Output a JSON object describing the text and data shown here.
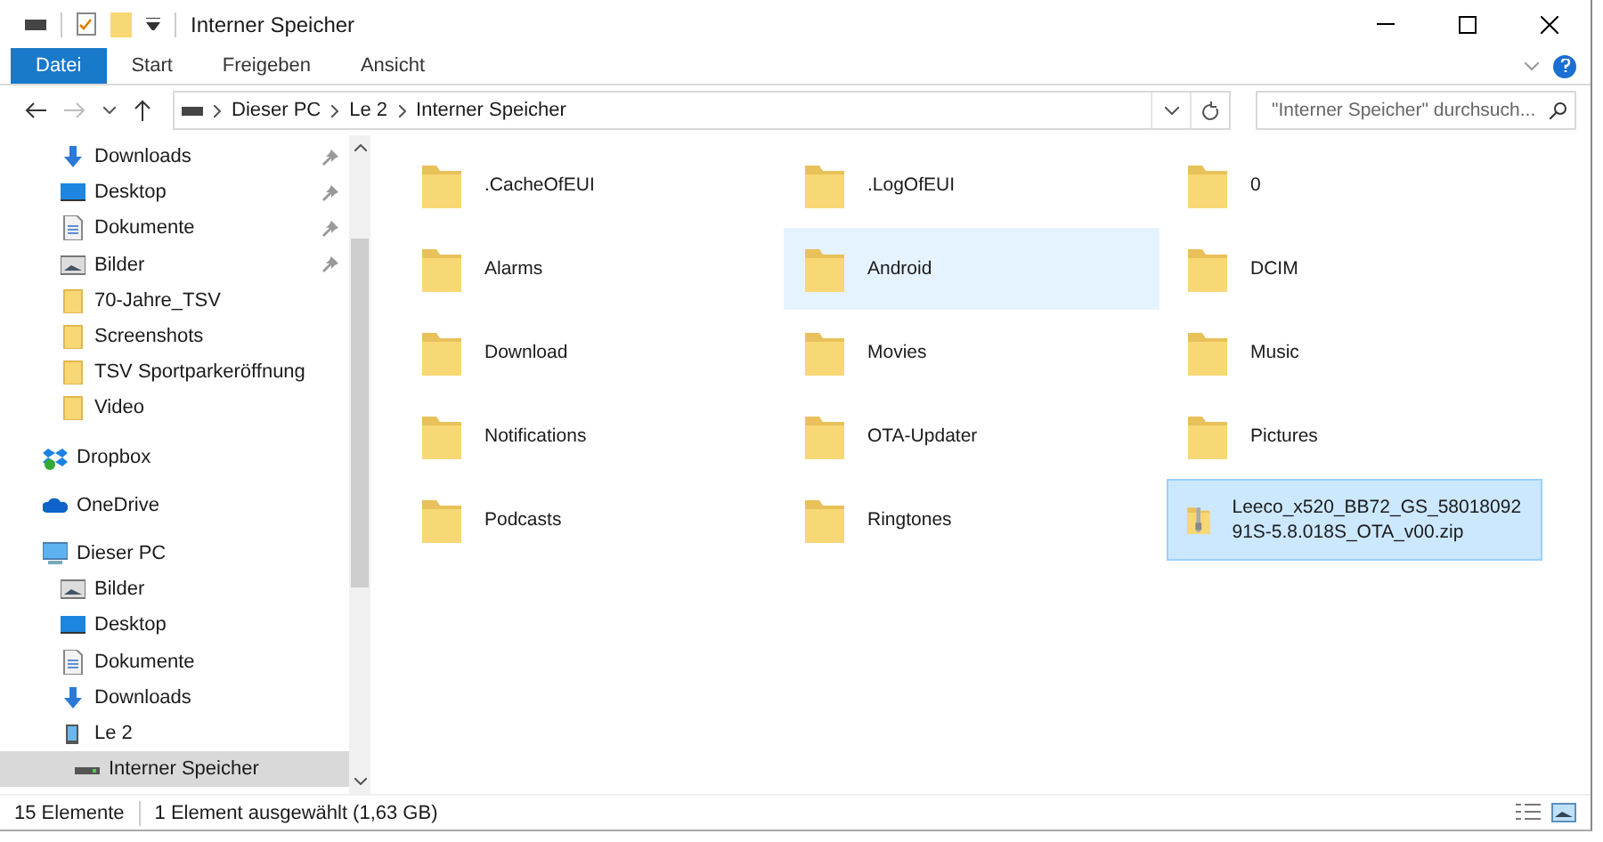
{
  "window": {
    "title": "Interner Speicher"
  },
  "ribbon_tabs": [
    {
      "label": "Datei",
      "selected": true
    },
    {
      "label": "Start",
      "selected": false
    },
    {
      "label": "Freigeben",
      "selected": false
    },
    {
      "label": "Ansicht",
      "selected": false
    }
  ],
  "address_bar": {
    "path": [
      "Dieser PC",
      "Le 2",
      "Interner Speicher"
    ]
  },
  "search": {
    "placeholder": "\"Interner Speicher\" durchsuch..."
  },
  "sidebar": {
    "items": [
      {
        "label": "Downloads",
        "kind": "download",
        "pinned": true,
        "selected": false
      },
      {
        "label": "Desktop",
        "kind": "desktop",
        "pinned": true,
        "selected": false
      },
      {
        "label": "Dokumente",
        "kind": "document",
        "pinned": true,
        "selected": false
      },
      {
        "label": "Bilder",
        "kind": "pictures",
        "pinned": true,
        "selected": false
      },
      {
        "label": "70-Jahre_TSV",
        "kind": "folder",
        "pinned": false,
        "selected": false
      },
      {
        "label": "Screenshots",
        "kind": "folder",
        "pinned": false,
        "selected": false
      },
      {
        "label": "TSV Sportparkeröffnung",
        "kind": "folder",
        "pinned": false,
        "selected": false
      },
      {
        "label": "Video",
        "kind": "folder",
        "pinned": false,
        "selected": false
      },
      {
        "label": "Dropbox",
        "kind": "dropbox",
        "pinned": false,
        "selected": false,
        "root": true
      },
      {
        "label": "OneDrive",
        "kind": "cloud",
        "pinned": false,
        "selected": false,
        "root": true
      },
      {
        "label": "Dieser PC",
        "kind": "pc",
        "pinned": false,
        "selected": false,
        "root": true,
        "children": [
          {
            "label": "Bilder",
            "kind": "pictures",
            "pinned": false,
            "selected": false
          },
          {
            "label": "Desktop",
            "kind": "desktop",
            "pinned": false,
            "selected": false
          },
          {
            "label": "Dokumente",
            "kind": "document",
            "pinned": false,
            "selected": false
          },
          {
            "label": "Downloads",
            "kind": "download",
            "pinned": false,
            "selected": false
          },
          {
            "label": "Le 2",
            "kind": "phone",
            "pinned": false,
            "selected": false,
            "children": [
              {
                "label": "Interner Speicher",
                "kind": "drive",
                "pinned": false,
                "selected": true
              }
            ]
          }
        ]
      }
    ]
  },
  "files": [
    {
      "name": ".CacheOfEUI",
      "kind": "folder",
      "selected": false,
      "hovered": false
    },
    {
      "name": ".LogOfEUI",
      "kind": "folder",
      "selected": false,
      "hovered": false
    },
    {
      "name": "0",
      "kind": "folder",
      "selected": false,
      "hovered": false
    },
    {
      "name": "Alarms",
      "kind": "folder",
      "selected": false,
      "hovered": false
    },
    {
      "name": "Android",
      "kind": "folder",
      "selected": false,
      "hovered": true
    },
    {
      "name": "DCIM",
      "kind": "folder",
      "selected": false,
      "hovered": false
    },
    {
      "name": "Download",
      "kind": "folder",
      "selected": false,
      "hovered": false
    },
    {
      "name": "Movies",
      "kind": "folder",
      "selected": false,
      "hovered": false
    },
    {
      "name": "Music",
      "kind": "folder",
      "selected": false,
      "hovered": false
    },
    {
      "name": "Notifications",
      "kind": "folder",
      "selected": false,
      "hovered": false
    },
    {
      "name": "OTA-Updater",
      "kind": "folder",
      "selected": false,
      "hovered": false
    },
    {
      "name": "Pictures",
      "kind": "folder",
      "selected": false,
      "hovered": false
    },
    {
      "name": "Podcasts",
      "kind": "folder",
      "selected": false,
      "hovered": false
    },
    {
      "name": "Ringtones",
      "kind": "folder",
      "selected": false,
      "hovered": false
    },
    {
      "name": "Leeco_x520_BB72_GS_5801809291S-5.8.018S_OTA_v00.zip",
      "kind": "zip",
      "selected": true,
      "hovered": false
    }
  ],
  "status_bar": {
    "count": "15 Elemente",
    "selection": "1 Element ausgewählt (1,63 GB)"
  }
}
